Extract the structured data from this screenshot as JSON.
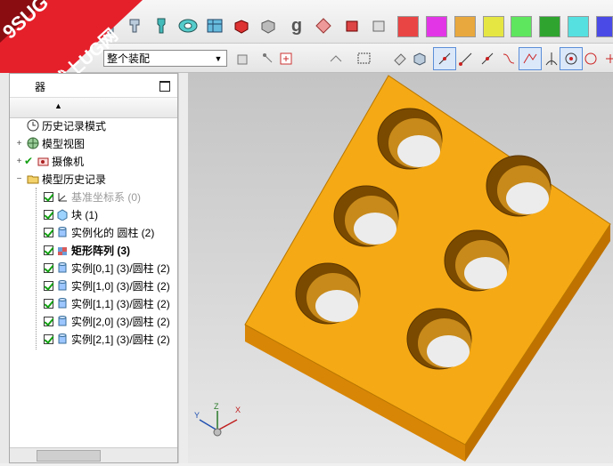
{
  "toolbar": {
    "assembly_filter": "整个装配",
    "swatch_colors": [
      "#e94545",
      "#e236e6",
      "#e9a83d",
      "#e6e643",
      "#5ee65e",
      "#2fa52f",
      "#56e0e0",
      "#4a4ae6"
    ]
  },
  "watermark": {
    "line1": "9SUG",
    "line2": "学UG就上UG网"
  },
  "navigator": {
    "title": "器",
    "rows": [
      {
        "label": "历史记录模式",
        "icon": "clock-icon",
        "indent": 0,
        "expander": "",
        "checked": false,
        "bold": false,
        "grey": false
      },
      {
        "label": "模型视图",
        "icon": "model-view-icon",
        "indent": 0,
        "expander": "+",
        "checked": false,
        "bold": false,
        "grey": false
      },
      {
        "label": "摄像机",
        "icon": "camera-icon",
        "indent": 0,
        "expander": "+",
        "checked": false,
        "bold": false,
        "grey": false,
        "tick": true
      },
      {
        "label": "模型历史记录",
        "icon": "folder-icon",
        "indent": 0,
        "expander": "−",
        "checked": false,
        "bold": false,
        "grey": false
      },
      {
        "label": "基准坐标系 (0)",
        "icon": "datum-csys-icon",
        "indent": 1,
        "expander": "",
        "checked": true,
        "bold": false,
        "grey": true
      },
      {
        "label": "块 (1)",
        "icon": "block-icon",
        "indent": 1,
        "expander": "",
        "checked": true,
        "bold": false,
        "grey": false
      },
      {
        "label": "实例化的 圆柱 (2)",
        "icon": "cylinder-icon",
        "indent": 1,
        "expander": "",
        "checked": true,
        "bold": false,
        "grey": false
      },
      {
        "label": "矩形阵列 (3)",
        "icon": "rect-array-icon",
        "indent": 1,
        "expander": "",
        "checked": true,
        "bold": true,
        "grey": false
      },
      {
        "label": "实例[0,1] (3)/圆柱 (2)",
        "icon": "cylinder-icon",
        "indent": 1,
        "expander": "",
        "checked": true,
        "bold": false,
        "grey": false
      },
      {
        "label": "实例[1,0] (3)/圆柱 (2)",
        "icon": "cylinder-icon",
        "indent": 1,
        "expander": "",
        "checked": true,
        "bold": false,
        "grey": false
      },
      {
        "label": "实例[1,1] (3)/圆柱 (2)",
        "icon": "cylinder-icon",
        "indent": 1,
        "expander": "",
        "checked": true,
        "bold": false,
        "grey": false
      },
      {
        "label": "实例[2,0] (3)/圆柱 (2)",
        "icon": "cylinder-icon",
        "indent": 1,
        "expander": "",
        "checked": true,
        "bold": false,
        "grey": false
      },
      {
        "label": "实例[2,1] (3)/圆柱 (2)",
        "icon": "cylinder-icon",
        "indent": 1,
        "expander": "",
        "checked": true,
        "bold": false,
        "grey": false
      }
    ]
  },
  "triad": {
    "x": "X",
    "y": "Y",
    "z": "Z"
  },
  "model": {
    "block_color": "#f5a914",
    "side_color": "#cf7d05",
    "hole_count": 6
  }
}
